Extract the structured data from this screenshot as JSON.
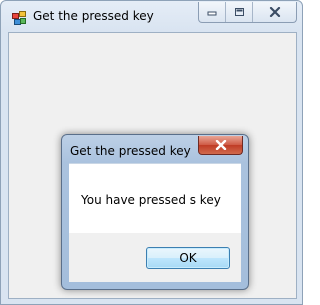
{
  "window": {
    "title": "Get the pressed key",
    "buttons": [
      "minimize-icon",
      "maximize-icon",
      "close-icon"
    ]
  },
  "dialog": {
    "title": "Get the pressed key",
    "message": "You have pressed s key",
    "ok_label": "OK"
  },
  "colors": {
    "client_background": "#f0f0f0",
    "dialog_close": "#c7432d",
    "ok_border": "#3c7fb1"
  }
}
